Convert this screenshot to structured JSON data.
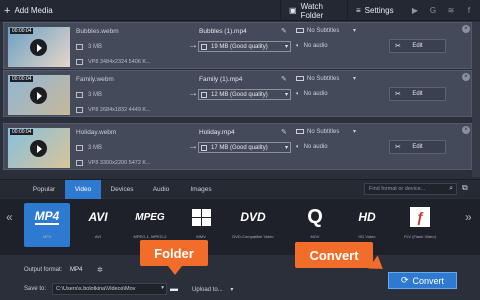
{
  "topbar": {
    "add_media": "Add Media",
    "watch_folder": "Watch Folder",
    "settings": "Settings",
    "social": [
      "youtube-icon",
      "google-plus-icon",
      "vk-icon",
      "facebook-icon"
    ]
  },
  "files": [
    {
      "timestamp": "00:00:04",
      "name": "Bubbles.webm",
      "size": "3 MB",
      "meta": "VP8 3484x2324 5406 K...",
      "output_name": "Bubbles (1).mp4",
      "subtitles": "No Subtitles",
      "quality": "19 MB (Good quality)",
      "audio": "No audio",
      "edit": "Edit",
      "thumb_colors": [
        "#6aa0c4",
        "#e7d6c9"
      ]
    },
    {
      "timestamp": "00:00:04",
      "name": "Family.webm",
      "size": "3 MB",
      "meta": "VP8 2684x1832 4449 K...",
      "output_name": "Family (1).mp4",
      "subtitles": "No Subtitles",
      "quality": "12 MB (Good quality)",
      "audio": "No audio",
      "edit": "Edit",
      "thumb_colors": [
        "#8fb7d6",
        "#c8b79a"
      ]
    },
    {
      "timestamp": "00:00:04",
      "name": "Holiday.webm",
      "size": "3 MB",
      "meta": "VP8 3300x2200 5472 K...",
      "output_name": "Holiday.mp4",
      "subtitles": "No Subtitles",
      "quality": "17 MB (Good quality)",
      "audio": "No audio",
      "edit": "Edit",
      "thumb_colors": [
        "#86c0de",
        "#d9c497"
      ]
    }
  ],
  "tabs": [
    "Popular",
    "Video",
    "Devices",
    "Audio",
    "Images"
  ],
  "active_tab": "Video",
  "search": {
    "placeholder": "Find format or device..."
  },
  "formats": [
    {
      "logo": "MP4",
      "label": "MP4"
    },
    {
      "logo": "AVI",
      "label": "AVI"
    },
    {
      "logo": "MPEG",
      "label": "MPEG-1, MPEG-2"
    },
    {
      "logo": "WMV",
      "label": "WMV"
    },
    {
      "logo": "DVD",
      "label": "DVD-Compatible Video"
    },
    {
      "logo": "MOV",
      "label": "MOV"
    },
    {
      "logo": "HD",
      "label": "HD Video"
    },
    {
      "logo": "FLV",
      "label": "FLV (Flash Video)"
    }
  ],
  "bottom": {
    "output_format_label": "Output format:",
    "output_format_value": "MP4",
    "save_to_label": "Save to:",
    "save_path": "C:\\Users\\s.bolotkina\\Videos\\Mov",
    "upload_to": "Upload to...",
    "convert": "Convert"
  },
  "callouts": {
    "folder": "Folder",
    "convert": "Convert"
  },
  "colors": {
    "accent": "#2e7ad1",
    "callout": "#f36d2a"
  }
}
